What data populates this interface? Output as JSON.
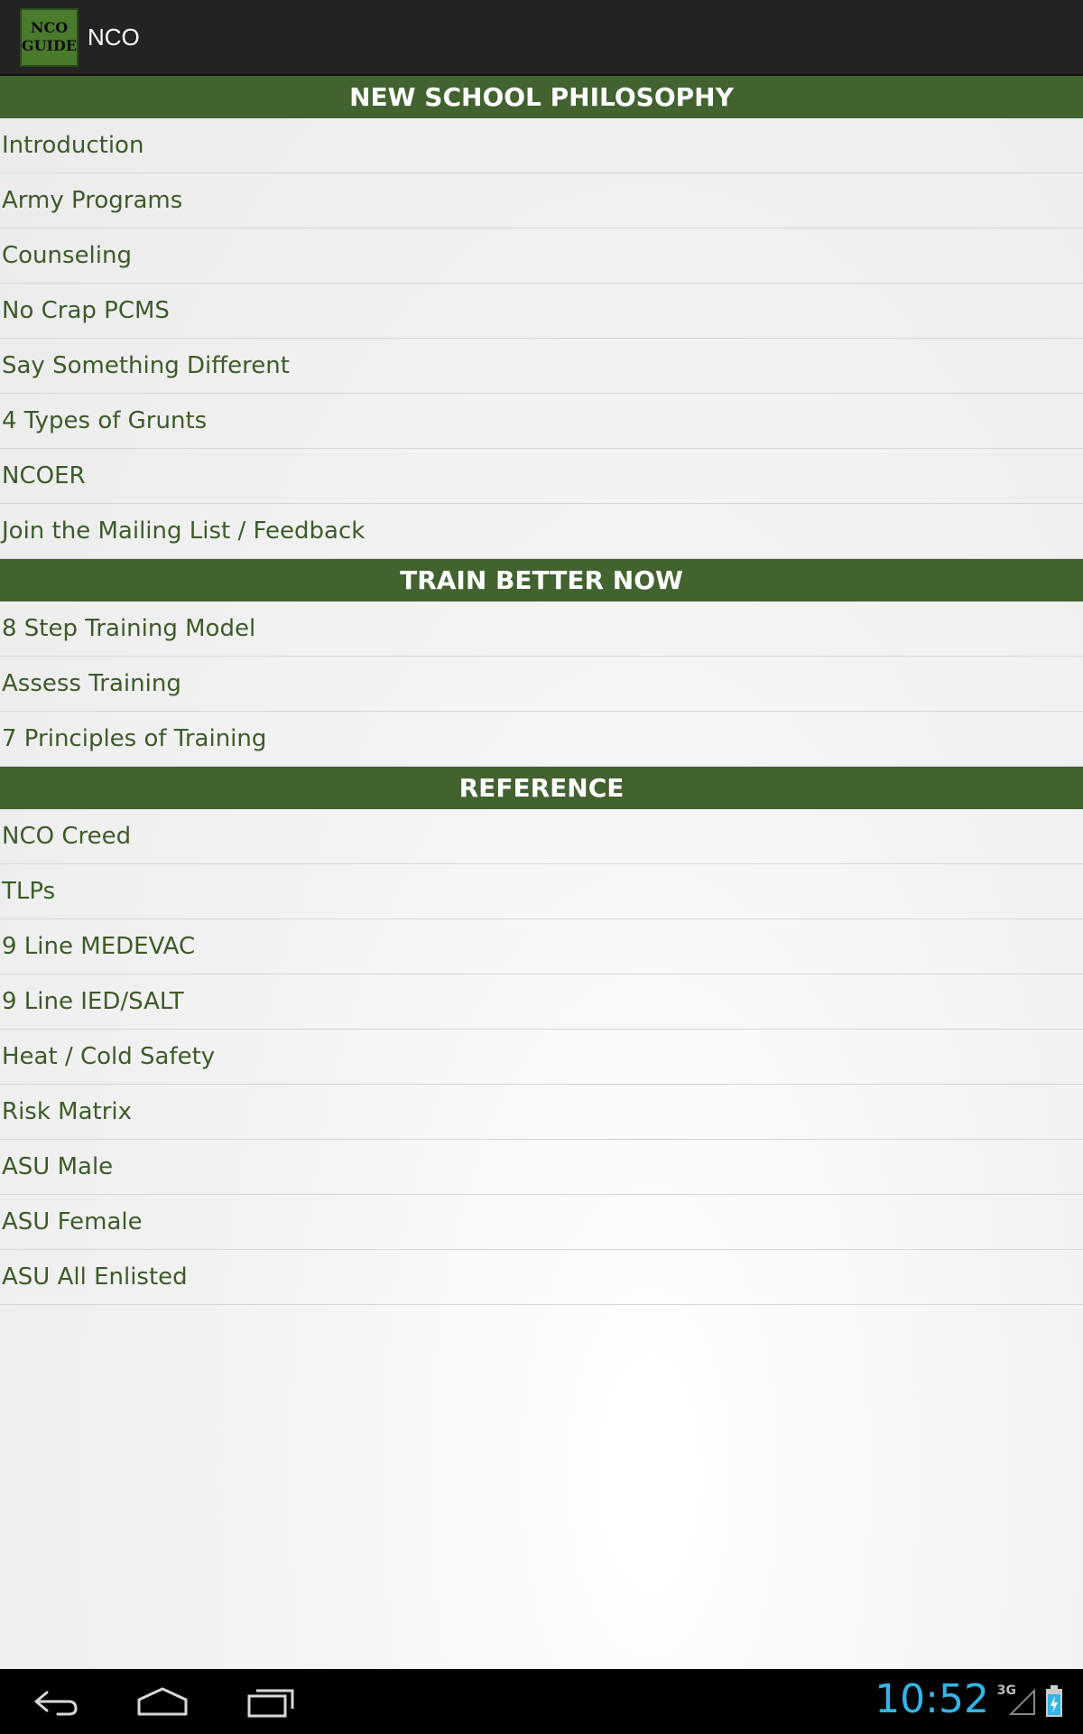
{
  "app": {
    "icon_line1": "NCO",
    "icon_line2": "GUIDE",
    "title": "NCO"
  },
  "sections": [
    {
      "header": "NEW SCHOOL PHILOSOPHY",
      "items": [
        "Introduction",
        "Army Programs",
        "Counseling",
        "No Crap PCMS",
        "Say Something Different",
        "4 Types of Grunts",
        "NCOER",
        "Join the Mailing List / Feedback"
      ]
    },
    {
      "header": "TRAIN BETTER NOW",
      "items": [
        "8 Step Training Model",
        "Assess Training",
        "7 Principles of Training"
      ]
    },
    {
      "header": "REFERENCE",
      "items": [
        "NCO Creed",
        "TLPs",
        "9 Line MEDEVAC",
        "9 Line IED/SALT",
        "Heat / Cold Safety",
        "Risk Matrix",
        "ASU Male",
        "ASU Female",
        "ASU All Enlisted"
      ]
    }
  ],
  "status": {
    "time": "10:52",
    "network": "3G"
  },
  "colors": {
    "header_bg": "#426230",
    "item_text": "#3e5a2a",
    "clock": "#33b5e5"
  },
  "icons": [
    "back-icon",
    "home-icon",
    "recent-apps-icon",
    "signal-icon",
    "battery-icon"
  ]
}
